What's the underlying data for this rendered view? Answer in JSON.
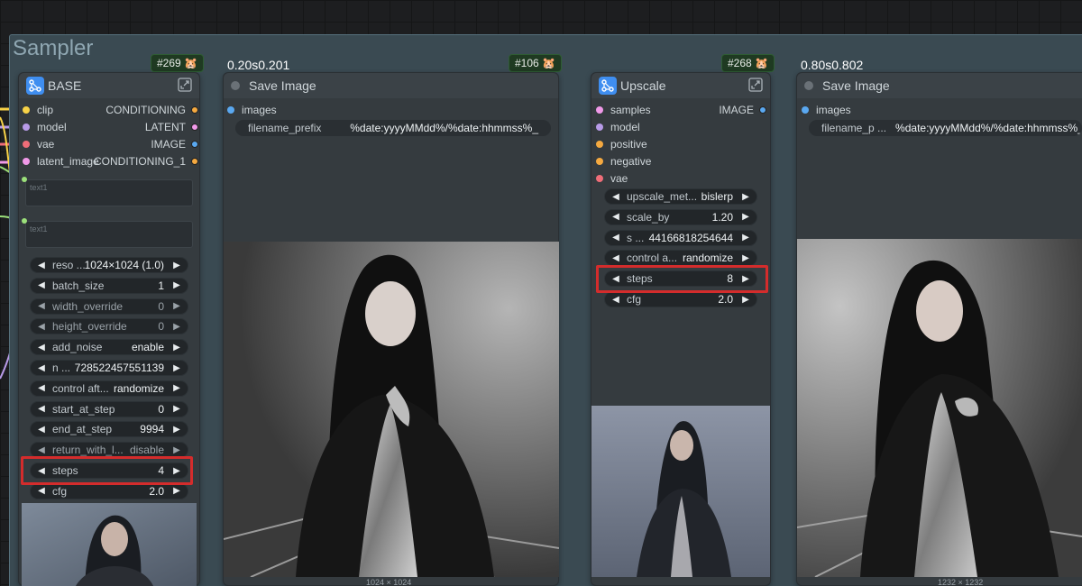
{
  "group": {
    "title": "Sampler"
  },
  "base": {
    "badge": "#269 🐹",
    "title": "BASE",
    "inputs": [
      {
        "name": "clip",
        "color": "#f7d247"
      },
      {
        "name": "model",
        "color": "#b89be8"
      },
      {
        "name": "vae",
        "color": "#ef6d78"
      },
      {
        "name": "latent_image",
        "color": "#f099e8"
      }
    ],
    "outputs": [
      {
        "name": "CONDITIONING",
        "color": "#f5a940"
      },
      {
        "name": "LATENT",
        "color": "#f099e8"
      },
      {
        "name": "IMAGE",
        "color": "#5aa8f0"
      },
      {
        "name": "CONDITIONING_1",
        "color": "#f5a940"
      }
    ],
    "text1": "text1",
    "text2": "text1",
    "widgets": [
      {
        "label": "reso ...",
        "value": "1024×1024 (1.0)"
      },
      {
        "label": "batch_size",
        "value": "1"
      },
      {
        "label": "width_override",
        "value": "0"
      },
      {
        "label": "height_override",
        "value": "0"
      },
      {
        "label": "add_noise",
        "value": "enable"
      },
      {
        "label": "n ...",
        "value": "728522457551139"
      },
      {
        "label": "control aft...",
        "value": "randomize"
      },
      {
        "label": "start_at_step",
        "value": "0"
      },
      {
        "label": "end_at_step",
        "value": "9994"
      },
      {
        "label": "return_with_l...",
        "value": "disable"
      },
      {
        "label": "steps",
        "value": "4"
      },
      {
        "label": "cfg",
        "value": "2.0"
      }
    ]
  },
  "save1": {
    "badge": "#106 🐹",
    "overlay": "0.20s0.201",
    "title": "Save Image",
    "input": "images",
    "field_label": "filename_prefix",
    "field_value": "%date:yyyyMMdd%/%date:hhmmss%_",
    "caption": "1024 × 1024"
  },
  "upscale": {
    "badge": "#268 🐹",
    "title": "Upscale",
    "inputs": [
      {
        "name": "samples",
        "color": "#f099e8"
      },
      {
        "name": "model",
        "color": "#b89be8"
      },
      {
        "name": "positive",
        "color": "#f5a940"
      },
      {
        "name": "negative",
        "color": "#f5a940"
      },
      {
        "name": "vae",
        "color": "#ef6d78"
      }
    ],
    "output": "IMAGE",
    "widgets": [
      {
        "label": "upscale_met...",
        "value": "bislerp"
      },
      {
        "label": "scale_by",
        "value": "1.20"
      },
      {
        "label": "s ...",
        "value": "44166818254644"
      },
      {
        "label": "control a...",
        "value": "randomize"
      },
      {
        "label": "steps",
        "value": "8"
      },
      {
        "label": "cfg",
        "value": "2.0"
      }
    ]
  },
  "save2": {
    "overlay": "0.80s0.802",
    "title": "Save Image",
    "input": "images",
    "field_label": "filename_p ...",
    "field_value": "%date:yyyyMMdd%/%date:hhmmss%_",
    "caption": "1232 × 1232"
  },
  "arrows": {
    "left": "◀",
    "right": "▶"
  },
  "colors": {
    "highlight": "#d42c2c",
    "badge_bg": "#1f3a22",
    "accent": "#3f8ef0"
  }
}
